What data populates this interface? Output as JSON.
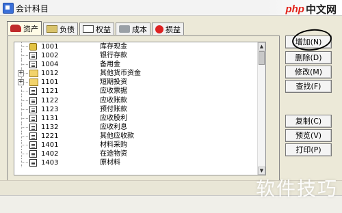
{
  "window": {
    "title": "会计科目"
  },
  "watermark": {
    "site_red": "php",
    "site_dark": "中文网",
    "caption": "软件技巧"
  },
  "tabs": [
    {
      "label": "资产",
      "icon": "car-icon",
      "active": true
    },
    {
      "label": "负债",
      "icon": "folder-icon",
      "active": false
    },
    {
      "label": "权益",
      "icon": "document-icon",
      "active": false
    },
    {
      "label": "成本",
      "icon": "tool-icon",
      "active": false
    },
    {
      "label": "损益",
      "icon": "apple-icon",
      "active": false
    }
  ],
  "accounts": [
    {
      "code": "1001",
      "name": "库存现金",
      "icon": "coins",
      "expandable": false
    },
    {
      "code": "1002",
      "name": "银行存款",
      "icon": "doc",
      "expandable": false
    },
    {
      "code": "1004",
      "name": "备用金",
      "icon": "doc",
      "expandable": false
    },
    {
      "code": "1012",
      "name": "其他货币资金",
      "icon": "folder",
      "expandable": true
    },
    {
      "code": "1101",
      "name": "短期投资",
      "icon": "folder",
      "expandable": true
    },
    {
      "code": "1121",
      "name": "应收票据",
      "icon": "doc",
      "expandable": false
    },
    {
      "code": "1122",
      "name": "应收账款",
      "icon": "doc",
      "expandable": false
    },
    {
      "code": "1123",
      "name": "预付账款",
      "icon": "doc",
      "expandable": false
    },
    {
      "code": "1131",
      "name": "应收股利",
      "icon": "doc",
      "expandable": false
    },
    {
      "code": "1132",
      "name": "应收利息",
      "icon": "doc",
      "expandable": false
    },
    {
      "code": "1221",
      "name": "其他应收款",
      "icon": "doc",
      "expandable": false
    },
    {
      "code": "1401",
      "name": "材料采购",
      "icon": "doc",
      "expandable": false
    },
    {
      "code": "1402",
      "name": "在途物资",
      "icon": "doc",
      "expandable": false
    },
    {
      "code": "1403",
      "name": "原材料",
      "icon": "doc",
      "expandable": false
    }
  ],
  "buttons": {
    "add": "增加(N)",
    "delete": "删除(D)",
    "modify": "修改(M)",
    "find": "查找(F)",
    "copy": "复制(C)",
    "preview": "预览(V)",
    "print": "打印(P)"
  },
  "colors": {
    "accent_red": "#e2231a",
    "tab_active_bg": "#fffbe6"
  }
}
